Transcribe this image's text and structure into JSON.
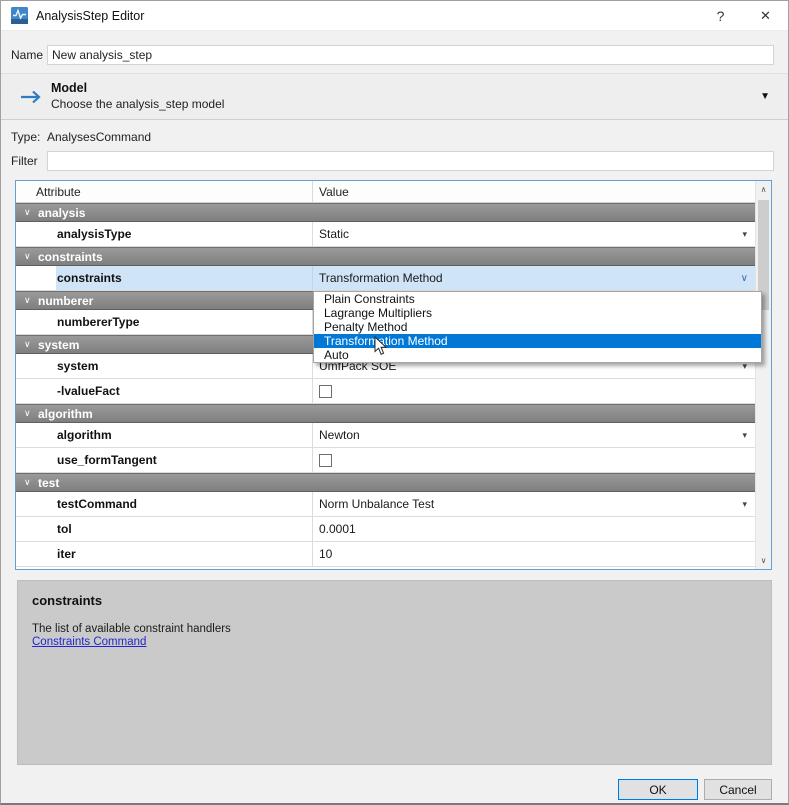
{
  "window": {
    "title": "AnalysisStep Editor",
    "help_label": "?",
    "close_label": "✕"
  },
  "name_field": {
    "label": "Name",
    "value": "New analysis_step"
  },
  "model_section": {
    "title": "Model",
    "subtitle": "Choose the analysis_step model"
  },
  "type_line": {
    "label": "Type:",
    "value": "AnalysesCommand"
  },
  "filter": {
    "label": "Filter",
    "value": ""
  },
  "table": {
    "headers": {
      "attribute": "Attribute",
      "value": "Value"
    },
    "rows": [
      {
        "type": "group",
        "label": "analysis"
      },
      {
        "type": "combo",
        "label": "analysisType",
        "value": "Static"
      },
      {
        "type": "group",
        "label": "constraints"
      },
      {
        "type": "combo-open",
        "label": "constraints",
        "value": "Transformation Method",
        "selected": true
      },
      {
        "type": "group",
        "label": "numberer"
      },
      {
        "type": "text",
        "label": "numbererType",
        "value": ""
      },
      {
        "type": "group",
        "label": "system"
      },
      {
        "type": "combo",
        "label": "system",
        "value": "UmfPack SOE"
      },
      {
        "type": "checkbox",
        "label": "-lvalueFact",
        "checked": false
      },
      {
        "type": "group",
        "label": "algorithm"
      },
      {
        "type": "combo",
        "label": "algorithm",
        "value": "Newton"
      },
      {
        "type": "checkbox",
        "label": "use_formTangent",
        "checked": false
      },
      {
        "type": "group",
        "label": "test"
      },
      {
        "type": "combo",
        "label": "testCommand",
        "value": "Norm Unbalance Test"
      },
      {
        "type": "text",
        "label": "tol",
        "value": "0.0001"
      },
      {
        "type": "text",
        "label": "iter",
        "value": "10"
      }
    ]
  },
  "dropdown": {
    "options": [
      "Plain Constraints",
      "Lagrange Multipliers",
      "Penalty Method",
      "Transformation Method",
      "Auto"
    ],
    "selected_index": 3,
    "selected_option": "Transformation Method"
  },
  "description": {
    "title": "constraints",
    "text": "The list of available constraint handlers",
    "link": "Constraints Command"
  },
  "buttons": {
    "ok": "OK",
    "cancel": "Cancel"
  },
  "colors": {
    "accent": "#0078d7",
    "selection_bg": "#cfe4f7",
    "group_bar": "#8c8c8c",
    "table_border": "#64a1d2",
    "link": "#2525cc"
  }
}
